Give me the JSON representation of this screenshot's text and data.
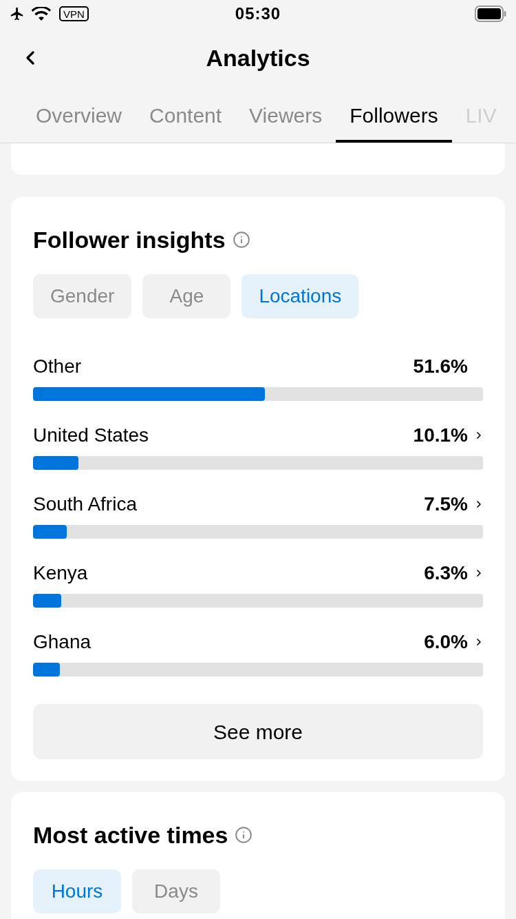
{
  "status_bar": {
    "vpn": "VPN",
    "time": "05:30"
  },
  "header": {
    "title": "Analytics"
  },
  "tabs": [
    {
      "label": "Overview",
      "selected": false
    },
    {
      "label": "Content",
      "selected": false
    },
    {
      "label": "Viewers",
      "selected": false
    },
    {
      "label": "Followers",
      "selected": true
    },
    {
      "label": "LIV",
      "selected": false
    }
  ],
  "follower_insights": {
    "title": "Follower insights",
    "filters": [
      {
        "label": "Gender",
        "selected": false
      },
      {
        "label": "Age",
        "selected": false
      },
      {
        "label": "Locations",
        "selected": true
      }
    ],
    "locations": [
      {
        "name": "Other",
        "share": "51.6%",
        "level": 0.516,
        "linked": false
      },
      {
        "name": "United States",
        "share": "10.1%",
        "level": 0.101,
        "linked": true
      },
      {
        "name": "South Africa",
        "share": "7.5%",
        "level": 0.075,
        "linked": true
      },
      {
        "name": "Kenya",
        "share": "6.3%",
        "level": 0.063,
        "linked": true
      },
      {
        "name": "Ghana",
        "share": "6.0%",
        "level": 0.06,
        "linked": true
      }
    ],
    "see_more": "See more"
  },
  "most_active_times": {
    "title": "Most active times",
    "filters": [
      {
        "label": "Hours",
        "selected": true
      },
      {
        "label": "Days",
        "selected": false
      }
    ]
  }
}
